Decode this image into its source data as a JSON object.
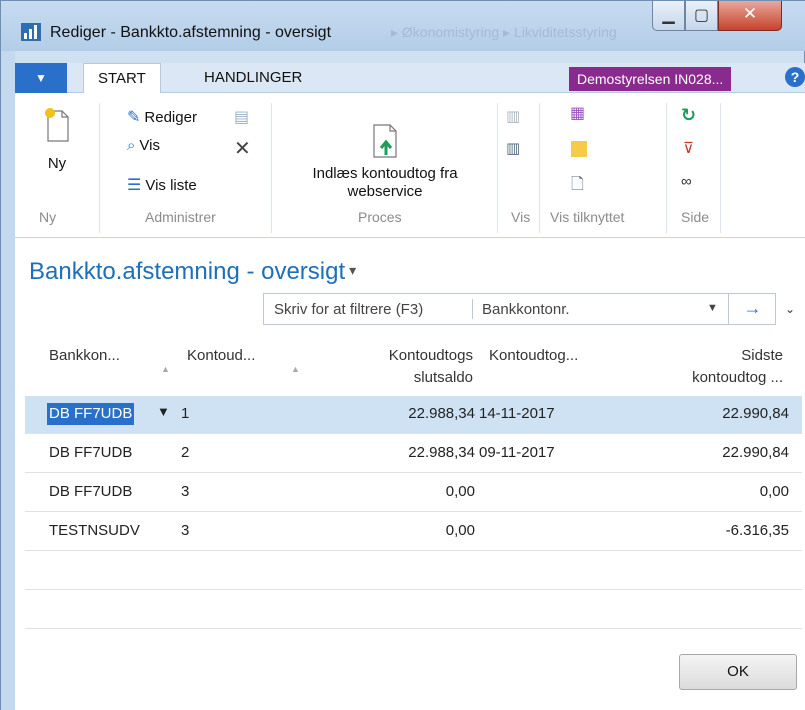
{
  "window": {
    "title": "Rediger - Bankkto.afstemning - oversigt",
    "ghost_breadcrumb": "▸ Økonomistyring ▸ Likviditetsstyring"
  },
  "ribbon": {
    "quick_menu": "▼",
    "tabs": [
      "START",
      "HANDLINGER"
    ],
    "company": "Demostyrelsen IN028...",
    "help": "?",
    "groups": {
      "ny": {
        "label": "Ny",
        "new_button": "Ny"
      },
      "administrer": {
        "label": "Administrer",
        "edit": "Rediger",
        "view": "Vis",
        "view_list": "Vis liste"
      },
      "proces": {
        "label": "Proces",
        "import_line1": "Indlæs kontoudtog fra",
        "import_line2": "webservice"
      },
      "vis": {
        "label": "Vis"
      },
      "vis_tilknyttet": {
        "label": "Vis tilknyttet"
      },
      "side": {
        "label": "Side"
      }
    }
  },
  "page": {
    "title": "Bankkto.afstemning - oversigt",
    "title_caret": "▾",
    "filter": {
      "placeholder": "Skriv for at filtrere (F3)",
      "field": "Bankkontonr.",
      "dropdown": "▼",
      "go": "→",
      "expand": "⌄"
    }
  },
  "table": {
    "headers": {
      "bank": "Bankkon...",
      "stmt_no": "Kontoud...",
      "balance_l1": "Kontoudtogs",
      "balance_l2": "slutsaldo",
      "date": "Kontoudtog...",
      "last_l1": "Sidste",
      "last_l2": "kontoudtog ..."
    },
    "rows": [
      {
        "bank": "DB FF7UDB",
        "stmt_no": "1",
        "balance": "22.988,34",
        "date": "14-11-2017",
        "last": "22.990,84",
        "selected": true
      },
      {
        "bank": "DB FF7UDB",
        "stmt_no": "2",
        "balance": "22.988,34",
        "date": "09-11-2017",
        "last": "22.990,84",
        "selected": false
      },
      {
        "bank": "DB FF7UDB",
        "stmt_no": "3",
        "balance": "0,00",
        "date": "",
        "last": "0,00",
        "selected": false
      },
      {
        "bank": "TESTNSUDV",
        "stmt_no": "3",
        "balance": "0,00",
        "date": "",
        "last": "-6.316,35",
        "selected": false
      }
    ]
  },
  "footer": {
    "ok": "OK"
  },
  "colors": {
    "accent": "#2a6fc9",
    "title_blue": "#1f6fb8",
    "company_badge": "#8a2a8f",
    "selected_row": "#cfe2f4"
  }
}
